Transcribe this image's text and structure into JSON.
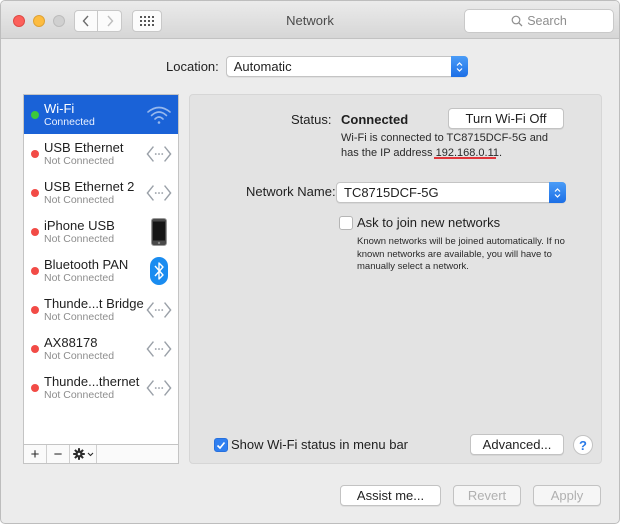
{
  "window": {
    "title": "Network",
    "search_placeholder": "Search"
  },
  "location": {
    "label": "Location:",
    "value": "Automatic"
  },
  "services": [
    {
      "name": "Wi-Fi",
      "status": "Connected",
      "dot_color": "#3cc93c",
      "icon": "wifi-icon",
      "selected": true
    },
    {
      "name": "USB Ethernet",
      "status": "Not Connected",
      "dot_color": "#f24b46",
      "icon": "ethernet-arrows-icon",
      "selected": false
    },
    {
      "name": "USB Ethernet 2",
      "status": "Not Connected",
      "dot_color": "#f24b46",
      "icon": "ethernet-arrows-icon",
      "selected": false
    },
    {
      "name": "iPhone USB",
      "status": "Not Connected",
      "dot_color": "#f24b46",
      "icon": "iphone-icon",
      "selected": false
    },
    {
      "name": "Bluetooth PAN",
      "status": "Not Connected",
      "dot_color": "#f24b46",
      "icon": "bluetooth-icon",
      "selected": false
    },
    {
      "name": "Thunde...t Bridge",
      "status": "Not Connected",
      "dot_color": "#f24b46",
      "icon": "ethernet-arrows-icon",
      "selected": false
    },
    {
      "name": "AX88178",
      "status": "Not Connected",
      "dot_color": "#f24b46",
      "icon": "ethernet-arrows-icon",
      "selected": false
    },
    {
      "name": "Thunde...thernet",
      "status": "Not Connected",
      "dot_color": "#f24b46",
      "icon": "ethernet-arrows-icon",
      "selected": false
    }
  ],
  "sidebar_tools": {
    "add": "+",
    "remove": "−"
  },
  "detail": {
    "status_label": "Status:",
    "status_value": "Connected",
    "toggle_button": "Turn Wi-Fi Off",
    "desc_line1": "Wi-Fi is connected to TC8715DCF-5G and",
    "desc_line2_prefix": "has the IP address ",
    "ip_address": "192.168.0.11.",
    "network_name_label": "Network Name:",
    "network_name_value": "TC8715DCF-5G",
    "ask_label": "Ask to join new networks",
    "ask_checked": false,
    "ask_desc": "Known networks will be joined automatically. If no known networks are available, you will have to manually select a network.",
    "show_status_label": "Show Wi-Fi status in menu bar",
    "show_status_checked": true,
    "advanced_button": "Advanced...",
    "help": "?"
  },
  "footer": {
    "assist_button": "Assist me...",
    "revert_button": "Revert",
    "apply_button": "Apply"
  },
  "colors": {
    "accent": "#1a62d7",
    "connected": "#3cc93c",
    "disconnected": "#f24b46",
    "ip_underline": "#e0363a"
  }
}
